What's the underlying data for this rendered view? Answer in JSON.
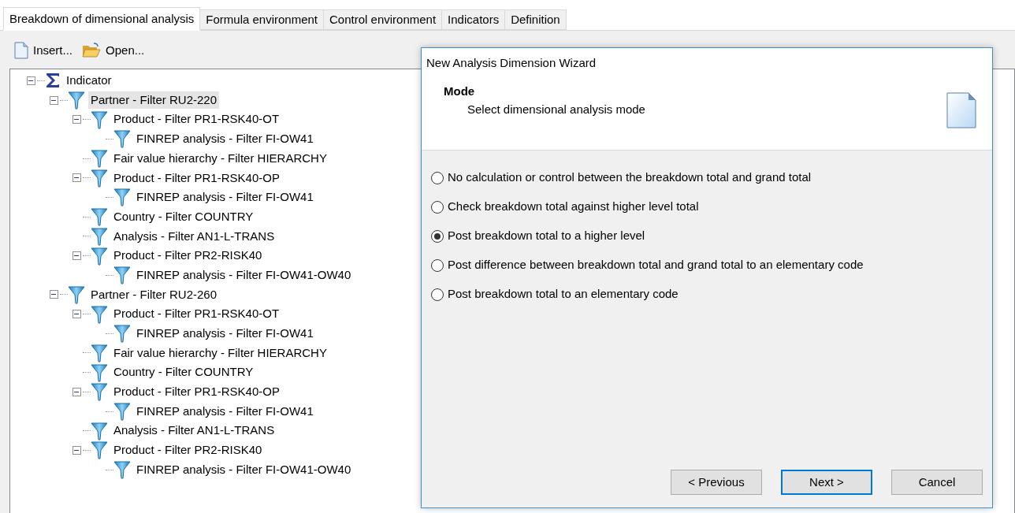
{
  "tabs": [
    {
      "label": "Breakdown of dimensional analysis",
      "selected": true
    },
    {
      "label": "Formula environment",
      "selected": false
    },
    {
      "label": "Control environment",
      "selected": false
    },
    {
      "label": "Indicators",
      "selected": false
    },
    {
      "label": "Definition",
      "selected": false
    }
  ],
  "toolbar": [
    {
      "kind": "new",
      "label": "Insert..."
    },
    {
      "kind": "open",
      "label": "Open..."
    }
  ],
  "tree": [
    {
      "kind": "sum",
      "label": "Indicator",
      "expanded": true,
      "selected": false,
      "children": [
        {
          "kind": "filter",
          "label": "Partner - Filter RU2-220",
          "expanded": true,
          "selected": true,
          "children": [
            {
              "kind": "filter",
              "label": "Product - Filter PR1-RSK40-OT",
              "expanded": true,
              "selected": false,
              "children": [
                {
                  "kind": "filter",
                  "label": "FINREP analysis - Filter FI-OW41",
                  "selected": false
                }
              ]
            },
            {
              "kind": "filter",
              "label": "Fair value hierarchy - Filter HIERARCHY",
              "selected": false
            },
            {
              "kind": "filter",
              "label": "Product - Filter PR1-RSK40-OP",
              "expanded": true,
              "selected": false,
              "children": [
                {
                  "kind": "filter",
                  "label": "FINREP analysis - Filter FI-OW41",
                  "selected": false
                }
              ]
            },
            {
              "kind": "filter",
              "label": "Country - Filter COUNTRY",
              "selected": false
            },
            {
              "kind": "filter",
              "label": "Analysis - Filter AN1-L-TRANS",
              "selected": false
            },
            {
              "kind": "filter",
              "label": "Product - Filter PR2-RISK40",
              "expanded": true,
              "selected": false,
              "children": [
                {
                  "kind": "filter",
                  "label": "FINREP analysis - Filter FI-OW41-OW40",
                  "selected": false
                }
              ]
            }
          ]
        },
        {
          "kind": "filter",
          "label": "Partner - Filter RU2-260",
          "expanded": true,
          "selected": false,
          "children": [
            {
              "kind": "filter",
              "label": "Product - Filter PR1-RSK40-OT",
              "expanded": true,
              "selected": false,
              "children": [
                {
                  "kind": "filter",
                  "label": "FINREP analysis - Filter FI-OW41",
                  "selected": false
                }
              ]
            },
            {
              "kind": "filter",
              "label": "Fair value hierarchy - Filter HIERARCHY",
              "selected": false
            },
            {
              "kind": "filter",
              "label": "Country - Filter COUNTRY",
              "selected": false
            },
            {
              "kind": "filter",
              "label": "Product - Filter PR1-RSK40-OP",
              "expanded": true,
              "selected": false,
              "children": [
                {
                  "kind": "filter",
                  "label": "FINREP analysis - Filter FI-OW41",
                  "selected": false
                }
              ]
            },
            {
              "kind": "filter",
              "label": "Analysis - Filter AN1-L-TRANS",
              "selected": false
            },
            {
              "kind": "filter",
              "label": "Product - Filter PR2-RISK40",
              "expanded": true,
              "selected": false,
              "children": [
                {
                  "kind": "filter",
                  "label": "FINREP analysis - Filter FI-OW41-OW40",
                  "selected": false
                }
              ]
            }
          ]
        }
      ]
    }
  ],
  "dialog": {
    "title": "New Analysis Dimension Wizard",
    "heading": "Mode",
    "subheading": "Select dimensional analysis mode",
    "options": [
      {
        "label": "No calculation or control between the breakdown total and grand total",
        "selected": false
      },
      {
        "label": "Check breakdown total against higher level total",
        "selected": false
      },
      {
        "label": "Post breakdown total to a higher level",
        "selected": true
      },
      {
        "label": "Post difference between breakdown total and grand total to an elementary code",
        "selected": false
      },
      {
        "label": "Post breakdown total to an elementary code",
        "selected": false
      }
    ],
    "buttons": [
      {
        "label": "< Previous",
        "default": false
      },
      {
        "label": "Next >",
        "default": true
      },
      {
        "label": "Cancel",
        "default": false
      }
    ]
  }
}
